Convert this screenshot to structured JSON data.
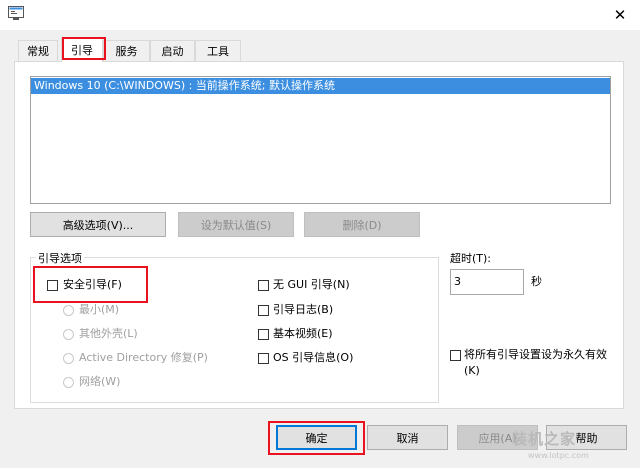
{
  "window": {
    "close_label": "✕",
    "app_icon": "msconfig-app-icon"
  },
  "tabs": [
    {
      "label": "常规",
      "active": false
    },
    {
      "label": "引导",
      "active": true
    },
    {
      "label": "服务",
      "active": false
    },
    {
      "label": "启动",
      "active": false
    },
    {
      "label": "工具",
      "active": false
    }
  ],
  "os_list": {
    "selected_entry": "Windows 10 (C:\\WINDOWS) : 当前操作系统; 默认操作系统"
  },
  "list_buttons": {
    "advanced": "高级选项(V)...",
    "set_default": "设为默认值(S)",
    "delete": "删除(D)"
  },
  "boot_options": {
    "group_title": "引导选项",
    "safe_boot": "安全引导(F)",
    "radios": {
      "minimal": "最小(M)",
      "alternate_shell": "其他外壳(L)",
      "active_directory": "Active Directory 修复(P)",
      "network": "网络(W)"
    },
    "no_gui": "无 GUI 引导(N)",
    "boot_log": "引导日志(B)",
    "base_video": "基本视频(E)",
    "os_boot_info": "OS 引导信息(O)"
  },
  "timeout": {
    "label": "超时(T):",
    "value": "3",
    "unit": "秒"
  },
  "permanent": {
    "line1": "将所有引导设置设为永久有效",
    "line2": "(K)"
  },
  "footer": {
    "ok": "确定",
    "cancel": "取消",
    "apply": "应用(A)",
    "help": "帮助"
  },
  "watermark": {
    "text": "装机之家",
    "url": "www.lotpc.com"
  },
  "colors": {
    "selection": "#3c8fe0",
    "highlight": "#e8131e"
  }
}
